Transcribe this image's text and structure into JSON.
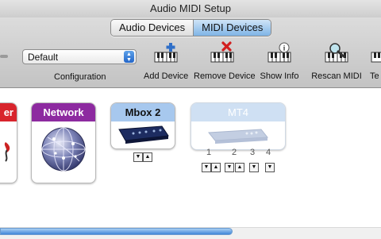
{
  "window": {
    "title": "Audio MIDI Setup"
  },
  "segmented": {
    "audio_label": "Audio Devices",
    "midi_label": "MIDI Devices"
  },
  "configuration": {
    "value": "Default",
    "label": "Configuration"
  },
  "toolbar": {
    "add_device": "Add Device",
    "remove_device": "Remove Device",
    "show_info": "Show Info",
    "rescan_midi": "Rescan MIDI",
    "test_setup_partial": "Te"
  },
  "devices": {
    "partial_label": "er",
    "network_label": "Network",
    "mbox_label": "Mbox 2",
    "mt4_label": "MT4",
    "mt4_ports": [
      "1",
      "2",
      "3",
      "4"
    ]
  },
  "colors": {
    "partial_header": "#d8242c",
    "network_header": "#8d2aa0",
    "mbox_header": "#a7c8ee",
    "mt4_header": "#cfe0f3",
    "selected_segment": "#7fb4e6"
  },
  "scroll": {
    "progress_fraction": 0.61
  }
}
